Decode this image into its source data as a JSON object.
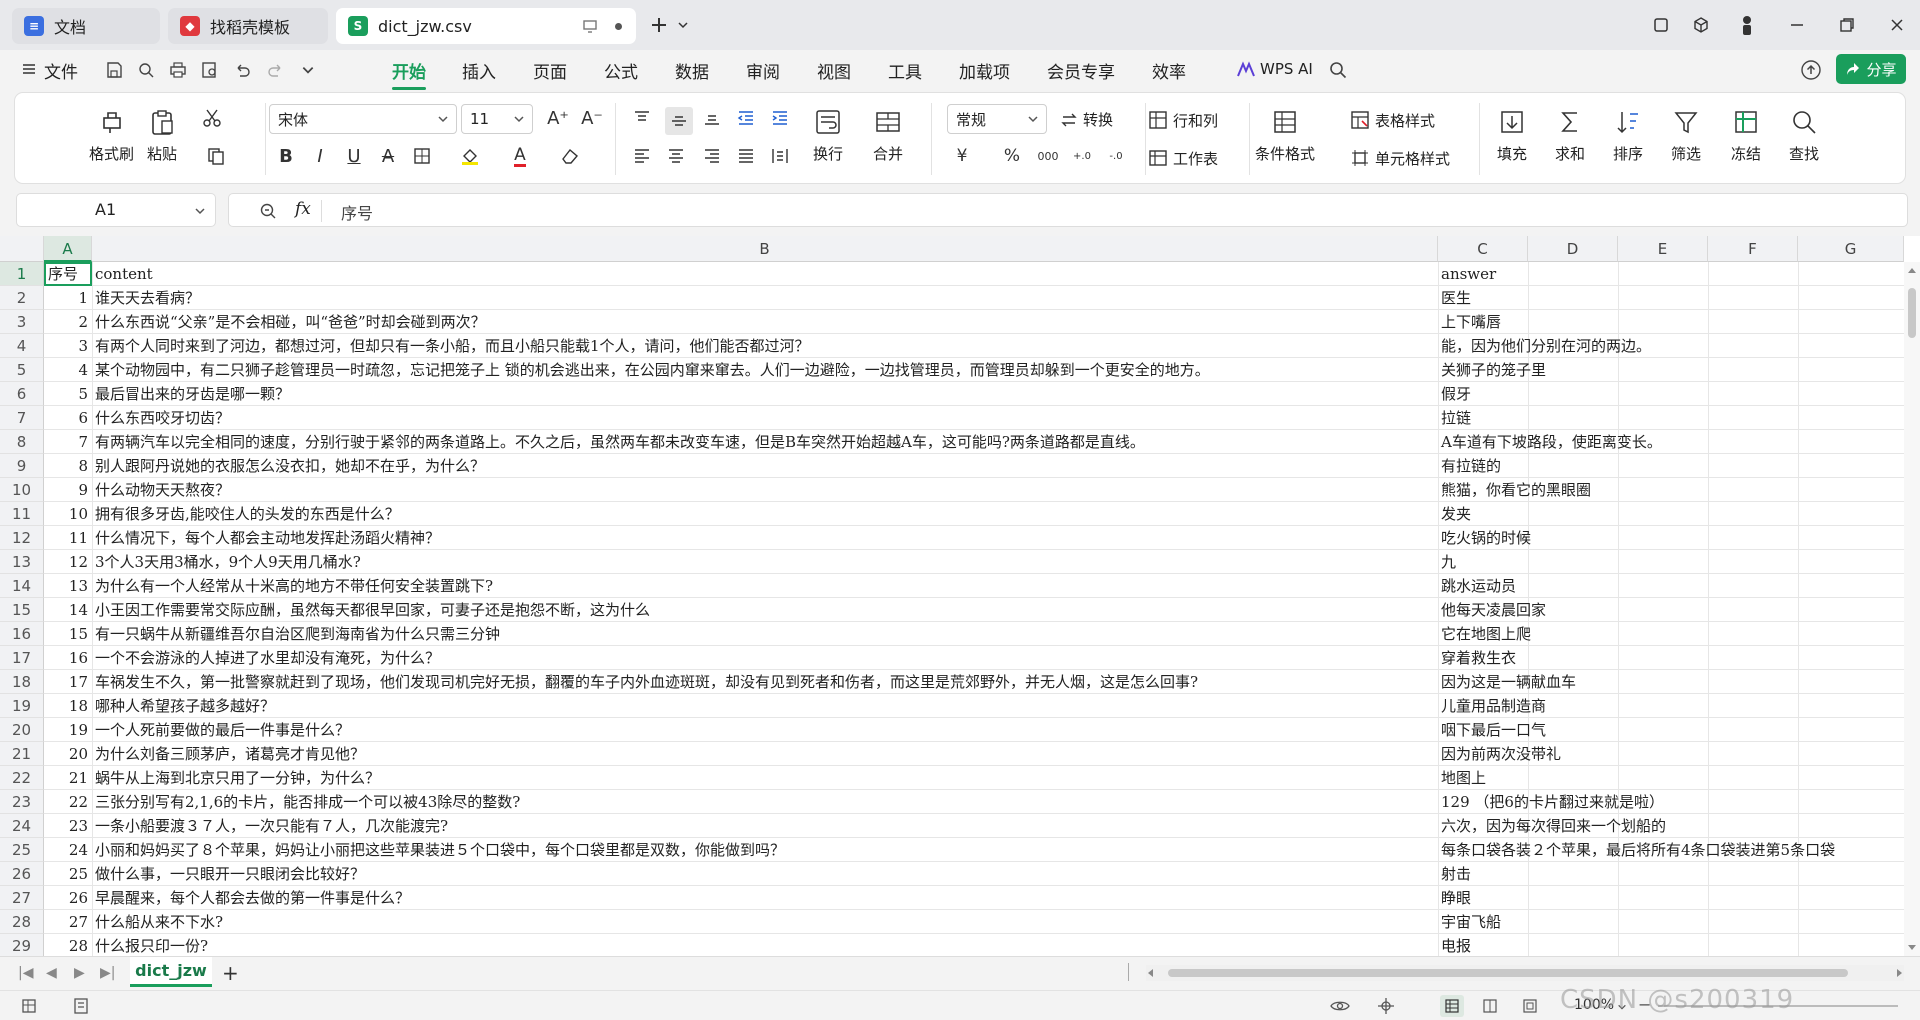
{
  "window": {
    "tabs": [
      {
        "label": "文档",
        "icon": "docs-icon",
        "color": "#3b6fe0"
      },
      {
        "label": "找稻壳模板",
        "icon": "docer-icon",
        "color": "#e0393e"
      },
      {
        "label": "dict_jzw.csv",
        "icon": "sheet-icon",
        "color": "#1a9e5c",
        "active": true
      }
    ]
  },
  "menu": {
    "file": "文件",
    "items": [
      "开始",
      "插入",
      "页面",
      "公式",
      "数据",
      "审阅",
      "视图",
      "工具",
      "加载项",
      "会员专享",
      "效率"
    ],
    "active": "开始",
    "ai": "WPS AI",
    "share": "分享"
  },
  "ribbon": {
    "format_painter": "格式刷",
    "paste": "粘贴",
    "font_name": "宋体",
    "font_size": "11",
    "wrap": "换行",
    "merge": "合并",
    "number_format": "常规",
    "convert": "转换",
    "rows_cols": "行和列",
    "worksheet": "工作表",
    "cond_format": "条件格式",
    "table_style": "表格样式",
    "cell_style": "单元格样式",
    "fill": "填充",
    "sum": "求和",
    "sort": "排序",
    "filter": "筛选",
    "freeze": "冻结",
    "find": "查找",
    "currency": "¥",
    "percent": "%"
  },
  "formula_bar": {
    "cell_ref": "A1",
    "content": "序号"
  },
  "columns": [
    "A",
    "B",
    "C",
    "D",
    "E",
    "F",
    "G"
  ],
  "rows": [
    {
      "n": "1",
      "a": "序号",
      "b": "content",
      "c": "answer"
    },
    {
      "n": "2",
      "a": "1",
      "b": "谁天天去看病？",
      "c": "医生"
    },
    {
      "n": "3",
      "a": "2",
      "b": "什么东西说“父亲”是不会相碰，叫“爸爸”时却会碰到两次？",
      "c": "上下嘴唇"
    },
    {
      "n": "4",
      "a": "3",
      "b": "有两个人同时来到了河边，都想过河，但却只有一条小船，而且小船只能载1个人，请问，他们能否都过河？",
      "c": "能，因为他们分别在河的两边。"
    },
    {
      "n": "5",
      "a": "4",
      "b": "某个动物园中，有二只狮子趁管理员一时疏忽，忘记把笼子上 锁的机会逃出来，在公园内窜来窜去。人们一边避险，一边找管理员，而管理员却躲到一个更安全的地方。",
      "c": "关狮子的笼子里"
    },
    {
      "n": "6",
      "a": "5",
      "b": "最后冒出来的牙齿是哪一颗？",
      "c": "假牙"
    },
    {
      "n": "7",
      "a": "6",
      "b": "什么东西咬牙切齿？",
      "c": "拉链"
    },
    {
      "n": "8",
      "a": "7",
      "b": "有两辆汽车以完全相同的速度，分别行驶于紧邻的两条道路上。不久之后，虽然两车都未改变车速，但是B车突然开始超越A车，这可能吗?两条道路都是直线。",
      "c": "A车道有下坡路段，使距离变长。"
    },
    {
      "n": "9",
      "a": "8",
      "b": "别人跟阿丹说她的衣服怎么没衣扣，她却不在乎，为什么？",
      "c": "有拉链的"
    },
    {
      "n": "10",
      "a": "9",
      "b": "什么动物天天熬夜？",
      "c": "熊猫，你看它的黑眼圈"
    },
    {
      "n": "11",
      "a": "10",
      "b": "拥有很多牙齿,能咬住人的头发的东西是什么？",
      "c": "发夹"
    },
    {
      "n": "12",
      "a": "11",
      "b": "什么情况下，每个人都会主动地发挥赴汤蹈火精神？",
      "c": "吃火锅的时候"
    },
    {
      "n": "13",
      "a": "12",
      "b": "3个人3天用3桶水，9个人9天用几桶水?",
      "c": "九"
    },
    {
      "n": "14",
      "a": "13",
      "b": "为什么有一个人经常从十米高的地方不带任何安全装置跳下?",
      "c": "跳水运动员"
    },
    {
      "n": "15",
      "a": "14",
      "b": "小王因工作需要常交际应酬，虽然每天都很早回家，可妻子还是抱怨不断，这为什么",
      "c": "他每天凌晨回家"
    },
    {
      "n": "16",
      "a": "15",
      "b": "有一只蜗牛从新疆维吾尔自治区爬到海南省为什么只需三分钟",
      "c": "它在地图上爬"
    },
    {
      "n": "17",
      "a": "16",
      "b": "一个不会游泳的人掉进了水里却没有淹死，为什么？",
      "c": "穿着救生衣"
    },
    {
      "n": "18",
      "a": "17",
      "b": "车祸发生不久，第一批警察就赶到了现场，他们发现司机完好无损，翻覆的车子内外血迹斑斑，却没有见到死者和伤者，而这里是荒郊野外，并无人烟，这是怎么回事?",
      "c": "因为这是一辆献血车"
    },
    {
      "n": "19",
      "a": "18",
      "b": "哪种人希望孩子越多越好？",
      "c": "儿童用品制造商"
    },
    {
      "n": "20",
      "a": "19",
      "b": "一个人死前要做的最后一件事是什么？",
      "c": "咽下最后一口气"
    },
    {
      "n": "21",
      "a": "20",
      "b": "为什么刘备三顾茅庐，诸葛亮才肯见他？",
      "c": "因为前两次没带礼"
    },
    {
      "n": "22",
      "a": "21",
      "b": "蜗牛从上海到北京只用了一分钟，为什么？",
      "c": "地图上"
    },
    {
      "n": "23",
      "a": "22",
      "b": "三张分别写有2,1,6的卡片，能否排成一个可以被43除尽的整数?",
      "c": "129 （把6的卡片翻过来就是啦）"
    },
    {
      "n": "24",
      "a": "23",
      "b": "一条小船要渡３７人，一次只能有７人，几次能渡完?",
      "c": "六次，因为每次得回来一个划船的"
    },
    {
      "n": "25",
      "a": "24",
      "b": "小丽和妈妈买了８个苹果，妈妈让小丽把这些苹果装进５个口袋中，每个口袋里都是双数，你能做到吗？",
      "c": "每条口袋各装２个苹果，最后将所有4条口袋装进第5条口袋"
    },
    {
      "n": "26",
      "a": "25",
      "b": "做什么事，一只眼开一只眼闭会比较好？",
      "c": "射击"
    },
    {
      "n": "27",
      "a": "26",
      "b": "早晨醒来，每个人都会去做的第一件事是什么？",
      "c": "睁眼"
    },
    {
      "n": "28",
      "a": "27",
      "b": "什么船从来不下水?",
      "c": "宇宙飞船"
    },
    {
      "n": "29",
      "a": "28",
      "b": "什么报只印一份?",
      "c": "电报"
    }
  ],
  "sheet_tab": "dict_jzw",
  "status": {
    "zoom": "100%",
    "watermark": "CSDN @s200319"
  },
  "colors": {
    "accent": "#1a9e5c"
  }
}
